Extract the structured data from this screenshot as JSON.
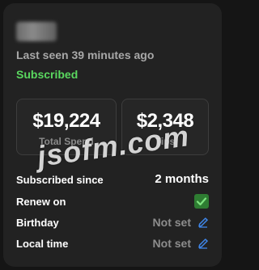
{
  "profile": {
    "last_seen": "Last seen 39 minutes ago",
    "subscription_status": "Subscribed"
  },
  "stats": {
    "total_spend_value": "$19,224",
    "total_spend_label": "Total Spend",
    "tips_value": "$2,348",
    "tips_label": "Tips"
  },
  "details": {
    "subscribed_since_label": "Subscribed since",
    "subscribed_since_value": "2 months",
    "renew_on_label": "Renew on",
    "renew_on_checked": true,
    "birthday_label": "Birthday",
    "birthday_value": "Not set",
    "local_time_label": "Local time",
    "local_time_value": "Not set"
  },
  "watermark": "jsofm.com",
  "colors": {
    "subscribed": "#5ad85f",
    "edit_icon": "#3f86e8",
    "checkbox": "#2e7d32"
  }
}
